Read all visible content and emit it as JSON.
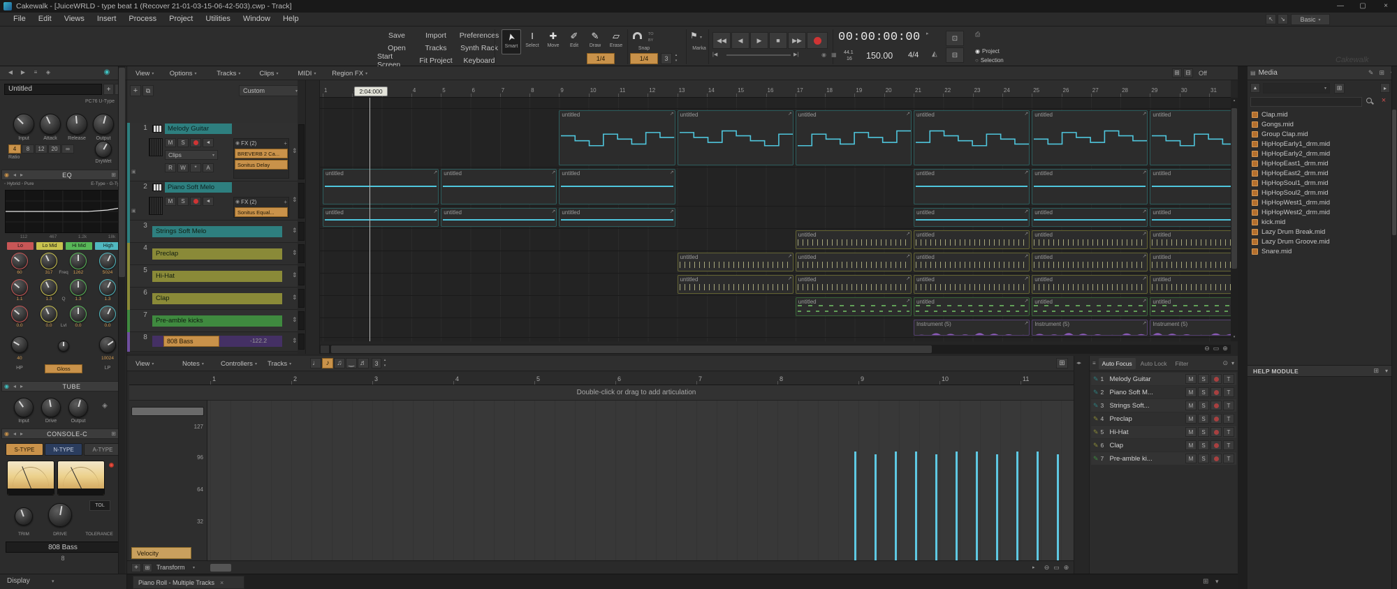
{
  "titlebar": {
    "title": "Cakewalk - [JuiceWRLD - type beat 1 (Recover 21-01-03-15-06-42-503).cwp - Track]",
    "workspace_label": "Basic",
    "brand": "Cakewalk"
  },
  "menubar": {
    "items": [
      "File",
      "Edit",
      "Views",
      "Insert",
      "Process",
      "Project",
      "Utilities",
      "Window",
      "Help"
    ]
  },
  "toolbar": {
    "file_buttons": [
      "Save",
      "Import",
      "Preferences",
      "Open",
      "Tracks",
      "Synth Rack",
      "Start Screen",
      "Fit Project",
      "Keyboard"
    ],
    "tools": [
      "Smart",
      "Select",
      "Move",
      "Edit",
      "Draw",
      "Erase"
    ],
    "selected_tool": "Smart",
    "draw_resolution": "1/4",
    "snap_label": "Snap",
    "snap_to": "TO",
    "snap_by": "BY",
    "snap_resolution": "1/4",
    "snap_count": "3",
    "markers_label": "Marka",
    "time_display": "00:00:00:00",
    "sample_rate": "44.1",
    "bit_depth": "16",
    "tempo": "150.00",
    "time_signature": "4/4",
    "scope_options": [
      "Project",
      "Selection"
    ],
    "scope_selected": "Project"
  },
  "inspector": {
    "track_name": "Untitled",
    "module_label": "PC76 U-Type",
    "comp_knobs": [
      "Input",
      "Attack",
      "Release",
      "Output"
    ],
    "ratio_buttons": [
      "4",
      "8",
      "12",
      "20",
      "∞"
    ],
    "ratio_label": "Ratio",
    "drywet_label": "DryWet",
    "eq_title": "EQ",
    "eq_modes_left": [
      "Hybrid",
      "Pure"
    ],
    "eq_modes_right": [
      "E-Type",
      "G-Type"
    ],
    "eq_freq_labels": [
      "112",
      "467",
      "1.2k",
      "18k"
    ],
    "bands": [
      {
        "name": "Lo",
        "color": "#c85656"
      },
      {
        "name": "Lo Mid",
        "color": "#c9c24e"
      },
      {
        "name": "Hi Mid",
        "color": "#58b858"
      },
      {
        "name": "High",
        "color": "#50b8c0"
      }
    ],
    "eq_rows": [
      {
        "label": "Freq",
        "values": [
          "60",
          "317",
          "1262",
          "5024"
        ]
      },
      {
        "label": "Q",
        "values": [
          "1.1",
          "1.3",
          "1.3",
          "1.3"
        ]
      },
      {
        "label": "Lvl",
        "values": [
          "0.0",
          "0.0",
          "0.0",
          "0.0"
        ]
      }
    ],
    "hp_value": "40",
    "lp_value": "10024",
    "hp_label": "HP",
    "gloss_label": "Gloss",
    "lp_label": "LP",
    "tube_title": "TUBE",
    "tube_knobs": [
      "Input",
      "Drive",
      "Output"
    ],
    "console_title": "CONSOLE-C",
    "console_types": [
      "S-TYPE",
      "N-TYPE",
      "A-TYPE"
    ],
    "console_knobs": [
      "TRIM",
      "DRIVE",
      "TOLERANCE"
    ],
    "tol_label": "TOL",
    "footer_name": "808 Bass",
    "footer_number": "8",
    "display_button": "Display"
  },
  "trackview": {
    "menus": [
      "View",
      "Options",
      "Tracks",
      "Clips",
      "MIDI",
      "Region FX"
    ],
    "off_label": "Off",
    "preset": "Custom",
    "now_marker": "2:04:000",
    "ruler_start": 1,
    "ruler_end": 31,
    "tracks": [
      {
        "num": "1",
        "name": "Melody Guitar",
        "color": "#2e7f7f",
        "buttons": [
          "M",
          "S"
        ],
        "automation_buttons": [
          "R",
          "W",
          "*",
          "A"
        ],
        "clips_dropdown": "Clips",
        "fx_header": "FX (2)",
        "fx_plugins": [
          "BREVERB 2 Ca...",
          "Sonitus Delay"
        ]
      },
      {
        "num": "2",
        "name": "Piano Soft Melo",
        "color": "#2e7f7f",
        "buttons": [
          "M",
          "S"
        ],
        "fx_header": "FX (2)",
        "fx_plugins": [
          "Sonitus Equal..."
        ]
      },
      {
        "num": "3",
        "name": "Strings Soft Melo",
        "color": "#2e7f7f"
      },
      {
        "num": "4",
        "name": "Preclap",
        "color": "#8a8a38"
      },
      {
        "num": "5",
        "name": "Hi-Hat",
        "color": "#8a8a38"
      },
      {
        "num": "6",
        "name": "Clap",
        "color": "#8a8a38"
      },
      {
        "num": "7",
        "name": "Pre-amble kicks",
        "color": "#3f8a3f"
      },
      {
        "num": "8",
        "name": "808 Bass",
        "color": "#6f4f9f",
        "gain_value": "-122.2"
      }
    ],
    "clips": [
      {
        "track": 1,
        "start": 9,
        "len": 4,
        "type": "melody",
        "label": "untitled"
      },
      {
        "track": 1,
        "start": 13,
        "len": 4,
        "type": "melody",
        "label": "untitled"
      },
      {
        "track": 1,
        "start": 17,
        "len": 4,
        "type": "melody",
        "label": "untitled"
      },
      {
        "track": 1,
        "start": 21,
        "len": 4,
        "type": "melody",
        "label": "untitled"
      },
      {
        "track": 1,
        "start": 25,
        "len": 4,
        "type": "melody",
        "label": "untitled"
      },
      {
        "track": 1,
        "start": 29,
        "len": 4,
        "type": "melody",
        "label": "untitled"
      },
      {
        "track": 2,
        "start": 1,
        "len": 4,
        "type": "flat",
        "label": "untitled"
      },
      {
        "track": 2,
        "start": 5,
        "len": 4,
        "type": "flat",
        "label": "untitled"
      },
      {
        "track": 2,
        "start": 9,
        "len": 4,
        "type": "flat",
        "label": "untitled"
      },
      {
        "track": 2,
        "start": 21,
        "len": 4,
        "type": "flat",
        "label": "untitled"
      },
      {
        "track": 2,
        "start": 25,
        "len": 4,
        "type": "flat",
        "label": "untitled"
      },
      {
        "track": 2,
        "start": 29,
        "len": 4,
        "type": "flat",
        "label": "untitled"
      },
      {
        "track": 3,
        "start": 1,
        "len": 4,
        "type": "flat",
        "label": "untitled"
      },
      {
        "track": 3,
        "start": 5,
        "len": 4,
        "type": "flat",
        "label": "untitled"
      },
      {
        "track": 3,
        "start": 9,
        "len": 4,
        "type": "flat",
        "label": "untitled"
      },
      {
        "track": 3,
        "start": 21,
        "len": 4,
        "type": "flat",
        "label": "untitled"
      },
      {
        "track": 3,
        "start": 25,
        "len": 4,
        "type": "flat",
        "label": "untitled"
      },
      {
        "track": 3,
        "start": 29,
        "len": 4,
        "type": "flat",
        "label": "untitled"
      },
      {
        "track": 4,
        "start": 17,
        "len": 4,
        "type": "ticks",
        "label": "untitled"
      },
      {
        "track": 4,
        "start": 21,
        "len": 4,
        "type": "ticks",
        "label": "untitled"
      },
      {
        "track": 4,
        "start": 25,
        "len": 4,
        "type": "ticks",
        "label": "untitled"
      },
      {
        "track": 4,
        "start": 29,
        "len": 4,
        "type": "ticks",
        "label": "untitled"
      },
      {
        "track": 5,
        "start": 13,
        "len": 4,
        "type": "ticks",
        "label": "untitled"
      },
      {
        "track": 5,
        "start": 17,
        "len": 4,
        "type": "ticks",
        "label": "untitled"
      },
      {
        "track": 5,
        "start": 21,
        "len": 4,
        "type": "ticks",
        "label": "untitled"
      },
      {
        "track": 5,
        "start": 25,
        "len": 4,
        "type": "ticks",
        "label": "untitled"
      },
      {
        "track": 5,
        "start": 29,
        "len": 4,
        "type": "ticks",
        "label": "untitled"
      },
      {
        "track": 6,
        "start": 13,
        "len": 4,
        "type": "ticks",
        "label": "untitled"
      },
      {
        "track": 6,
        "start": 17,
        "len": 4,
        "type": "ticks",
        "label": "untitled"
      },
      {
        "track": 6,
        "start": 21,
        "len": 4,
        "type": "ticks",
        "label": "untitled"
      },
      {
        "track": 6,
        "start": 25,
        "len": 4,
        "type": "ticks",
        "label": "untitled"
      },
      {
        "track": 6,
        "start": 29,
        "len": 4,
        "type": "ticks",
        "label": "untitled"
      },
      {
        "track": 7,
        "start": 17,
        "len": 4,
        "type": "kick",
        "label": "untitled"
      },
      {
        "track": 7,
        "start": 21,
        "len": 4,
        "type": "kick",
        "label": "untitled"
      },
      {
        "track": 7,
        "start": 25,
        "len": 4,
        "type": "kick",
        "label": "untitled"
      },
      {
        "track": 7,
        "start": 29,
        "len": 4,
        "type": "kick",
        "label": "untitled"
      },
      {
        "track": 8,
        "start": 21,
        "len": 4,
        "type": "bass",
        "label": "Instrument (5)"
      },
      {
        "track": 8,
        "start": 25,
        "len": 4,
        "type": "bass",
        "label": "Instrument (5)"
      },
      {
        "track": 8,
        "start": 29,
        "len": 4,
        "type": "bass",
        "label": "Instrument (5)"
      }
    ]
  },
  "media": {
    "title": "Media",
    "files": [
      "Clap.mid",
      "Gongs.mid",
      "Group Clap.mid",
      "HipHopEarly1_drm.mid",
      "HipHopEarly2_drm.mid",
      "HipHopEast1_drm.mid",
      "HipHopEast2_drm.mid",
      "HipHopSoul1_drm.mid",
      "HipHopSoul2_drm.mid",
      "HipHopWest1_drm.mid",
      "HipHopWest2_drm.mid",
      "kick.mid",
      "Lazy Drum Break.mid",
      "Lazy Drum Groove.mid",
      "Snare.mid"
    ]
  },
  "multidock": {
    "pianoroll": {
      "menus": [
        "View",
        "Notes",
        "Controllers",
        "Tracks"
      ],
      "tuplet_value": "3",
      "articulation_hint": "Double-click or drag to add articulation",
      "scale_values": [
        "127",
        "96",
        "64",
        "32"
      ],
      "velocity_label": "Velocity",
      "transform_label": "Transform",
      "ruler_start": 1,
      "ruler_end": 11,
      "velocity_values": [
        88,
        86,
        88,
        88,
        86,
        88,
        88,
        86,
        88,
        88,
        86
      ]
    },
    "autofocus": {
      "tabs": [
        "Auto Focus",
        "Auto Lock",
        "Filter"
      ],
      "active_tab": "Auto Focus",
      "row_buttons": [
        "M",
        "S",
        "T"
      ],
      "rows": [
        {
          "num": "1",
          "name": "Melody Guitar",
          "color": "#2e7f7f"
        },
        {
          "num": "2",
          "name": "Piano Soft M...",
          "color": "#2e7f7f"
        },
        {
          "num": "3",
          "name": "Strings Soft...",
          "color": "#2e7f7f"
        },
        {
          "num": "4",
          "name": "Preclap",
          "color": "#8a8a38"
        },
        {
          "num": "5",
          "name": "Hi-Hat",
          "color": "#8a8a38"
        },
        {
          "num": "6",
          "name": "Clap",
          "color": "#8a8a38"
        },
        {
          "num": "7",
          "name": "Pre-amble ki...",
          "color": "#3f8a3f"
        }
      ]
    }
  },
  "help": {
    "title": "HELP MODULE"
  },
  "tabbar": {
    "tab_title": "Piano Roll - Multiple Tracks"
  }
}
